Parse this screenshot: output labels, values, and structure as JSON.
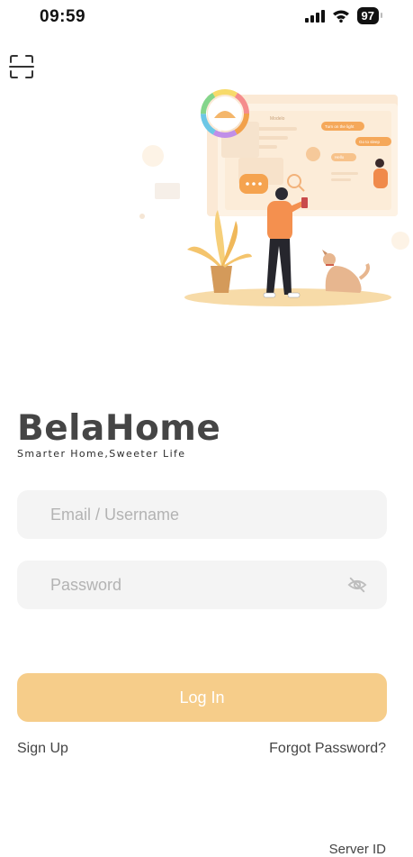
{
  "status_bar": {
    "time": "09:59",
    "battery": "97"
  },
  "brand": {
    "name": "BelaHome",
    "tagline": "Smarter Home,Sweeter Life"
  },
  "illustration": {
    "screen_title": "Modelo",
    "bubbles": [
      "Turn on the light",
      "Go to sleep",
      "Hello"
    ]
  },
  "login": {
    "email_placeholder": "Email / Username",
    "password_placeholder": "Password",
    "login_label": "Log In"
  },
  "links": {
    "sign_up": "Sign Up",
    "forgot_password": "Forgot Password?",
    "server_id": "Server ID"
  },
  "colors": {
    "accent": "#f6cd8a",
    "field_bg": "#f4f4f4",
    "orange": "#f0a04b"
  },
  "icons": {
    "scan": "scan-icon",
    "eye": "eye-off-icon",
    "signal": "signal-icon",
    "wifi": "wifi-icon",
    "battery": "battery-icon"
  }
}
